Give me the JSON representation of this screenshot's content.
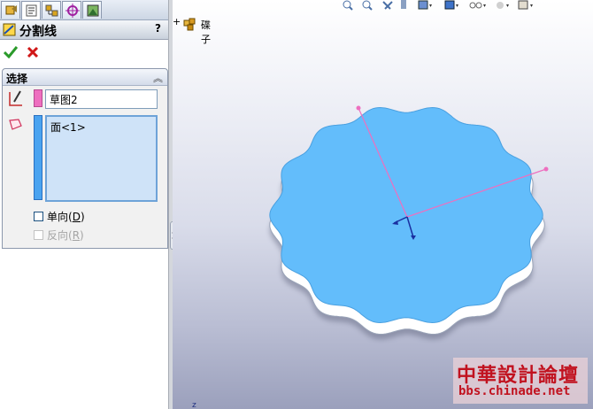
{
  "panel": {
    "title": "分割线",
    "help_label": "?",
    "section_title": "选择",
    "sketch_field_value": "草图2",
    "faces_list": [
      "面<1>"
    ],
    "single_direction_label": "单向",
    "single_direction_key": "D",
    "reverse_label": "反向",
    "reverse_key": "R"
  },
  "tree": {
    "part_name": "碟子",
    "expand_symbol": "+"
  },
  "watermark": {
    "line1": "中華設計論壇",
    "line2": "bbs.chinade.net"
  },
  "colors": {
    "face": "#63bdfb",
    "sketch": "#ee6fbf",
    "accent_blue": "#4a7fcd"
  },
  "icons": {
    "tabs": [
      "feature-manager-icon",
      "property-manager-icon",
      "configuration-manager-icon",
      "dimxpert-icon",
      "display-manager-icon"
    ],
    "hud": [
      "zoom-to-fit-icon",
      "zoom-area-icon",
      "previous-view-icon",
      "section-view-icon",
      "view-orientation-icon",
      "display-style-icon",
      "hide-show-icon",
      "edit-appearance-icon",
      "scene-icon"
    ]
  }
}
